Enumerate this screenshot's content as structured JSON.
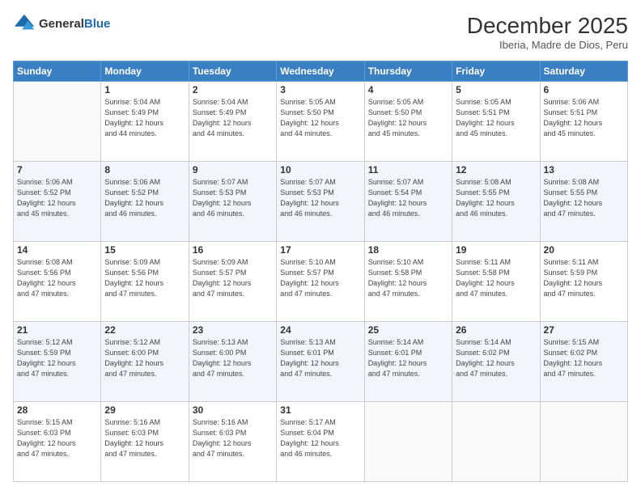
{
  "logo": {
    "general": "General",
    "blue": "Blue"
  },
  "title": "December 2025",
  "location": "Iberia, Madre de Dios, Peru",
  "weekdays": [
    "Sunday",
    "Monday",
    "Tuesday",
    "Wednesday",
    "Thursday",
    "Friday",
    "Saturday"
  ],
  "weeks": [
    [
      {
        "day": "",
        "info": ""
      },
      {
        "day": "1",
        "info": "Sunrise: 5:04 AM\nSunset: 5:49 PM\nDaylight: 12 hours\nand 44 minutes."
      },
      {
        "day": "2",
        "info": "Sunrise: 5:04 AM\nSunset: 5:49 PM\nDaylight: 12 hours\nand 44 minutes."
      },
      {
        "day": "3",
        "info": "Sunrise: 5:05 AM\nSunset: 5:50 PM\nDaylight: 12 hours\nand 44 minutes."
      },
      {
        "day": "4",
        "info": "Sunrise: 5:05 AM\nSunset: 5:50 PM\nDaylight: 12 hours\nand 45 minutes."
      },
      {
        "day": "5",
        "info": "Sunrise: 5:05 AM\nSunset: 5:51 PM\nDaylight: 12 hours\nand 45 minutes."
      },
      {
        "day": "6",
        "info": "Sunrise: 5:06 AM\nSunset: 5:51 PM\nDaylight: 12 hours\nand 45 minutes."
      }
    ],
    [
      {
        "day": "7",
        "info": "Sunrise: 5:06 AM\nSunset: 5:52 PM\nDaylight: 12 hours\nand 45 minutes."
      },
      {
        "day": "8",
        "info": "Sunrise: 5:06 AM\nSunset: 5:52 PM\nDaylight: 12 hours\nand 46 minutes."
      },
      {
        "day": "9",
        "info": "Sunrise: 5:07 AM\nSunset: 5:53 PM\nDaylight: 12 hours\nand 46 minutes."
      },
      {
        "day": "10",
        "info": "Sunrise: 5:07 AM\nSunset: 5:53 PM\nDaylight: 12 hours\nand 46 minutes."
      },
      {
        "day": "11",
        "info": "Sunrise: 5:07 AM\nSunset: 5:54 PM\nDaylight: 12 hours\nand 46 minutes."
      },
      {
        "day": "12",
        "info": "Sunrise: 5:08 AM\nSunset: 5:55 PM\nDaylight: 12 hours\nand 46 minutes."
      },
      {
        "day": "13",
        "info": "Sunrise: 5:08 AM\nSunset: 5:55 PM\nDaylight: 12 hours\nand 47 minutes."
      }
    ],
    [
      {
        "day": "14",
        "info": "Sunrise: 5:08 AM\nSunset: 5:56 PM\nDaylight: 12 hours\nand 47 minutes."
      },
      {
        "day": "15",
        "info": "Sunrise: 5:09 AM\nSunset: 5:56 PM\nDaylight: 12 hours\nand 47 minutes."
      },
      {
        "day": "16",
        "info": "Sunrise: 5:09 AM\nSunset: 5:57 PM\nDaylight: 12 hours\nand 47 minutes."
      },
      {
        "day": "17",
        "info": "Sunrise: 5:10 AM\nSunset: 5:57 PM\nDaylight: 12 hours\nand 47 minutes."
      },
      {
        "day": "18",
        "info": "Sunrise: 5:10 AM\nSunset: 5:58 PM\nDaylight: 12 hours\nand 47 minutes."
      },
      {
        "day": "19",
        "info": "Sunrise: 5:11 AM\nSunset: 5:58 PM\nDaylight: 12 hours\nand 47 minutes."
      },
      {
        "day": "20",
        "info": "Sunrise: 5:11 AM\nSunset: 5:59 PM\nDaylight: 12 hours\nand 47 minutes."
      }
    ],
    [
      {
        "day": "21",
        "info": "Sunrise: 5:12 AM\nSunset: 5:59 PM\nDaylight: 12 hours\nand 47 minutes."
      },
      {
        "day": "22",
        "info": "Sunrise: 5:12 AM\nSunset: 6:00 PM\nDaylight: 12 hours\nand 47 minutes."
      },
      {
        "day": "23",
        "info": "Sunrise: 5:13 AM\nSunset: 6:00 PM\nDaylight: 12 hours\nand 47 minutes."
      },
      {
        "day": "24",
        "info": "Sunrise: 5:13 AM\nSunset: 6:01 PM\nDaylight: 12 hours\nand 47 minutes."
      },
      {
        "day": "25",
        "info": "Sunrise: 5:14 AM\nSunset: 6:01 PM\nDaylight: 12 hours\nand 47 minutes."
      },
      {
        "day": "26",
        "info": "Sunrise: 5:14 AM\nSunset: 6:02 PM\nDaylight: 12 hours\nand 47 minutes."
      },
      {
        "day": "27",
        "info": "Sunrise: 5:15 AM\nSunset: 6:02 PM\nDaylight: 12 hours\nand 47 minutes."
      }
    ],
    [
      {
        "day": "28",
        "info": "Sunrise: 5:15 AM\nSunset: 6:03 PM\nDaylight: 12 hours\nand 47 minutes."
      },
      {
        "day": "29",
        "info": "Sunrise: 5:16 AM\nSunset: 6:03 PM\nDaylight: 12 hours\nand 47 minutes."
      },
      {
        "day": "30",
        "info": "Sunrise: 5:16 AM\nSunset: 6:03 PM\nDaylight: 12 hours\nand 47 minutes."
      },
      {
        "day": "31",
        "info": "Sunrise: 5:17 AM\nSunset: 6:04 PM\nDaylight: 12 hours\nand 46 minutes."
      },
      {
        "day": "",
        "info": ""
      },
      {
        "day": "",
        "info": ""
      },
      {
        "day": "",
        "info": ""
      }
    ]
  ]
}
